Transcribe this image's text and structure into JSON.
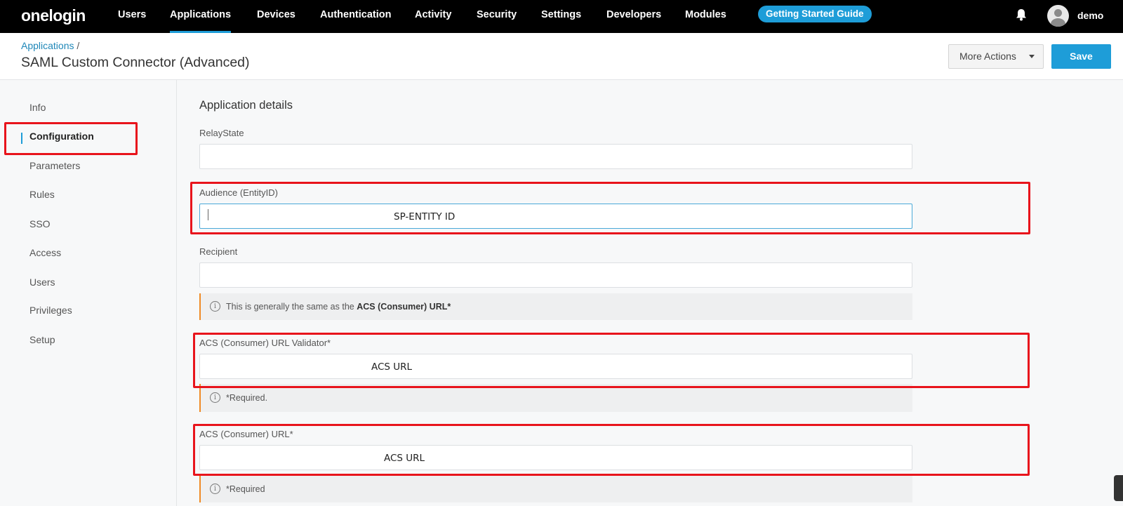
{
  "nav": {
    "logo": "onelogin",
    "items": [
      "Users",
      "Applications",
      "Devices",
      "Authentication",
      "Activity",
      "Security",
      "Settings",
      "Developers",
      "Modules"
    ],
    "guide": "Getting Started Guide",
    "user": "demo"
  },
  "header": {
    "breadcrumb": "Applications",
    "breadcrumb_sep": "/",
    "title": "SAML Custom Connector (Advanced)",
    "more_actions": "More Actions",
    "save": "Save"
  },
  "sidebar": {
    "items": [
      "Info",
      "Configuration",
      "Parameters",
      "Rules",
      "SSO",
      "Access",
      "Users",
      "Privileges",
      "Setup"
    ],
    "active": "Configuration"
  },
  "main": {
    "section_title": "Application details",
    "relay_state": {
      "label": "RelayState",
      "value": ""
    },
    "audience": {
      "label": "Audience (EntityID)",
      "value": "SP-ENTITY ID"
    },
    "recipient": {
      "label": "Recipient",
      "value": ""
    },
    "recipient_note": {
      "prefix": "This is generally the same as the ",
      "bold": "ACS (Consumer) URL*"
    },
    "acs_validator": {
      "label": "ACS (Consumer) URL Validator*",
      "value": "ACS URL"
    },
    "acs_validator_note": "*Required.",
    "acs_url": {
      "label": "ACS (Consumer) URL*",
      "value": "ACS URL"
    },
    "acs_url_note": "*Required"
  },
  "colors": {
    "nav_bg": "#000000",
    "accent": "#1e9dd8",
    "highlight": "#e8141c",
    "note_border": "#f08a24"
  },
  "icons": {
    "bell": "bell-icon",
    "avatar": "user-avatar-icon",
    "info": "info-circle-icon"
  }
}
